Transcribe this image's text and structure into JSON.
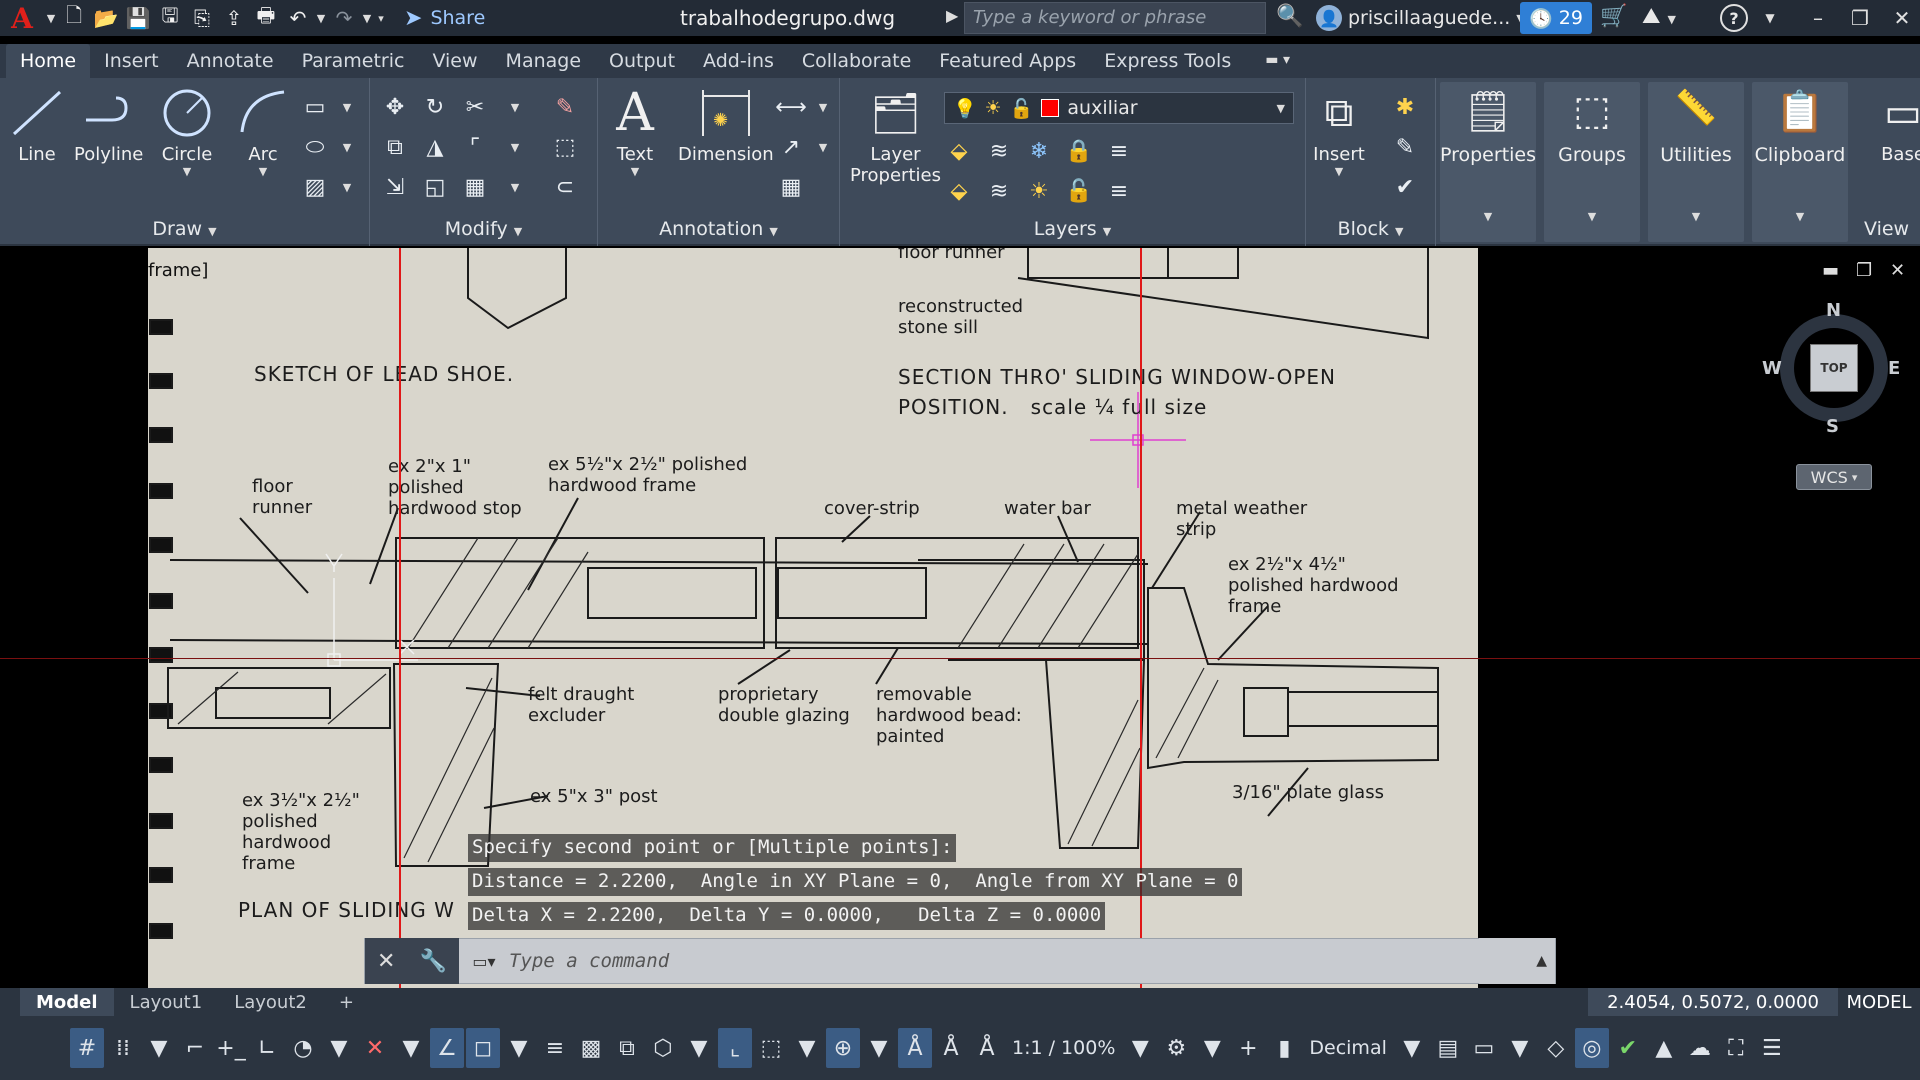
{
  "titlebar": {
    "share_label": "Share",
    "file_name": "trabalhodegrupo.dwg",
    "search_placeholder": "Type a keyword or phrase",
    "user_name": "priscillaaguede...",
    "notifications": "29"
  },
  "ribbon_tabs": [
    "Home",
    "Insert",
    "Annotate",
    "Parametric",
    "View",
    "Manage",
    "Output",
    "Add-ins",
    "Collaborate",
    "Featured Apps",
    "Express Tools"
  ],
  "ribbon": {
    "draw": {
      "title": "Draw",
      "line": "Line",
      "polyline": "Polyline",
      "circle": "Circle",
      "arc": "Arc"
    },
    "modify": {
      "title": "Modify"
    },
    "annotation": {
      "title": "Annotation",
      "text": "Text",
      "dimension": "Dimension"
    },
    "layers": {
      "title": "Layers",
      "layer_properties_1": "Layer",
      "layer_properties_2": "Properties",
      "current_layer": "auxiliar",
      "layer_color": "#ff0000"
    },
    "block": {
      "title": "Block",
      "insert": "Insert"
    },
    "properties": "Properties",
    "groups": "Groups",
    "utilities": "Utilities",
    "clipboard": "Clipboard",
    "view": {
      "title": "View",
      "base": "Base"
    }
  },
  "viewport": {
    "view_label": "frame]",
    "viewcube": {
      "top": "TOP",
      "n": "N",
      "s": "S",
      "e": "E",
      "w": "W"
    },
    "ucs": "WCS"
  },
  "drawing_text": {
    "floor_runner_top": "floor runner",
    "reconstructed": "reconstructed\nstone sill",
    "sketch_title": "SKETCH OF LEAD SHOE.",
    "section_title": "SECTION THRO' SLIDING WINDOW-OPEN\nPOSITION.   scale ¼ full size",
    "floor_runner": "floor\nrunner",
    "stop": "ex 2\"x 1\"\npolished\nhardwood stop",
    "frame_top": "ex 5½\"x 2½\" polished\nhardwood frame",
    "cover_strip": "cover-strip",
    "water_bar": "water bar",
    "metal_strip": "metal weather\nstrip",
    "frame_right": "ex 2½\"x 4½\"\npolished hardwood\nframe",
    "felt": "felt draught\nexcluder",
    "glazing": "proprietary\ndouble glazing",
    "bead": "removable\nhardwood bead:\npainted",
    "post": "ex 5\"x 3\" post",
    "plate_glass": "3/16\" plate glass",
    "frame_left": "ex 3½\"x 2½\"\npolished\nhardwood\nframe",
    "plan_title": "PLAN OF SLIDING W"
  },
  "tooltip": {
    "line1": "Specify second point or [Multiple points]:",
    "line2": "Distance = 2.2200,  Angle in XY Plane = 0,  Angle from XY Plane = 0",
    "line3": "Delta X = 2.2200,  Delta Y = 0.0000,   Delta Z = 0.0000"
  },
  "command": {
    "placeholder": "Type a command"
  },
  "layout_tabs": [
    "Model",
    "Layout1",
    "Layout2"
  ],
  "status": {
    "coords": "2.4054, 0.5072, 0.0000",
    "space": "MODEL",
    "scale": "1:1 / 100%",
    "units": "Decimal"
  }
}
